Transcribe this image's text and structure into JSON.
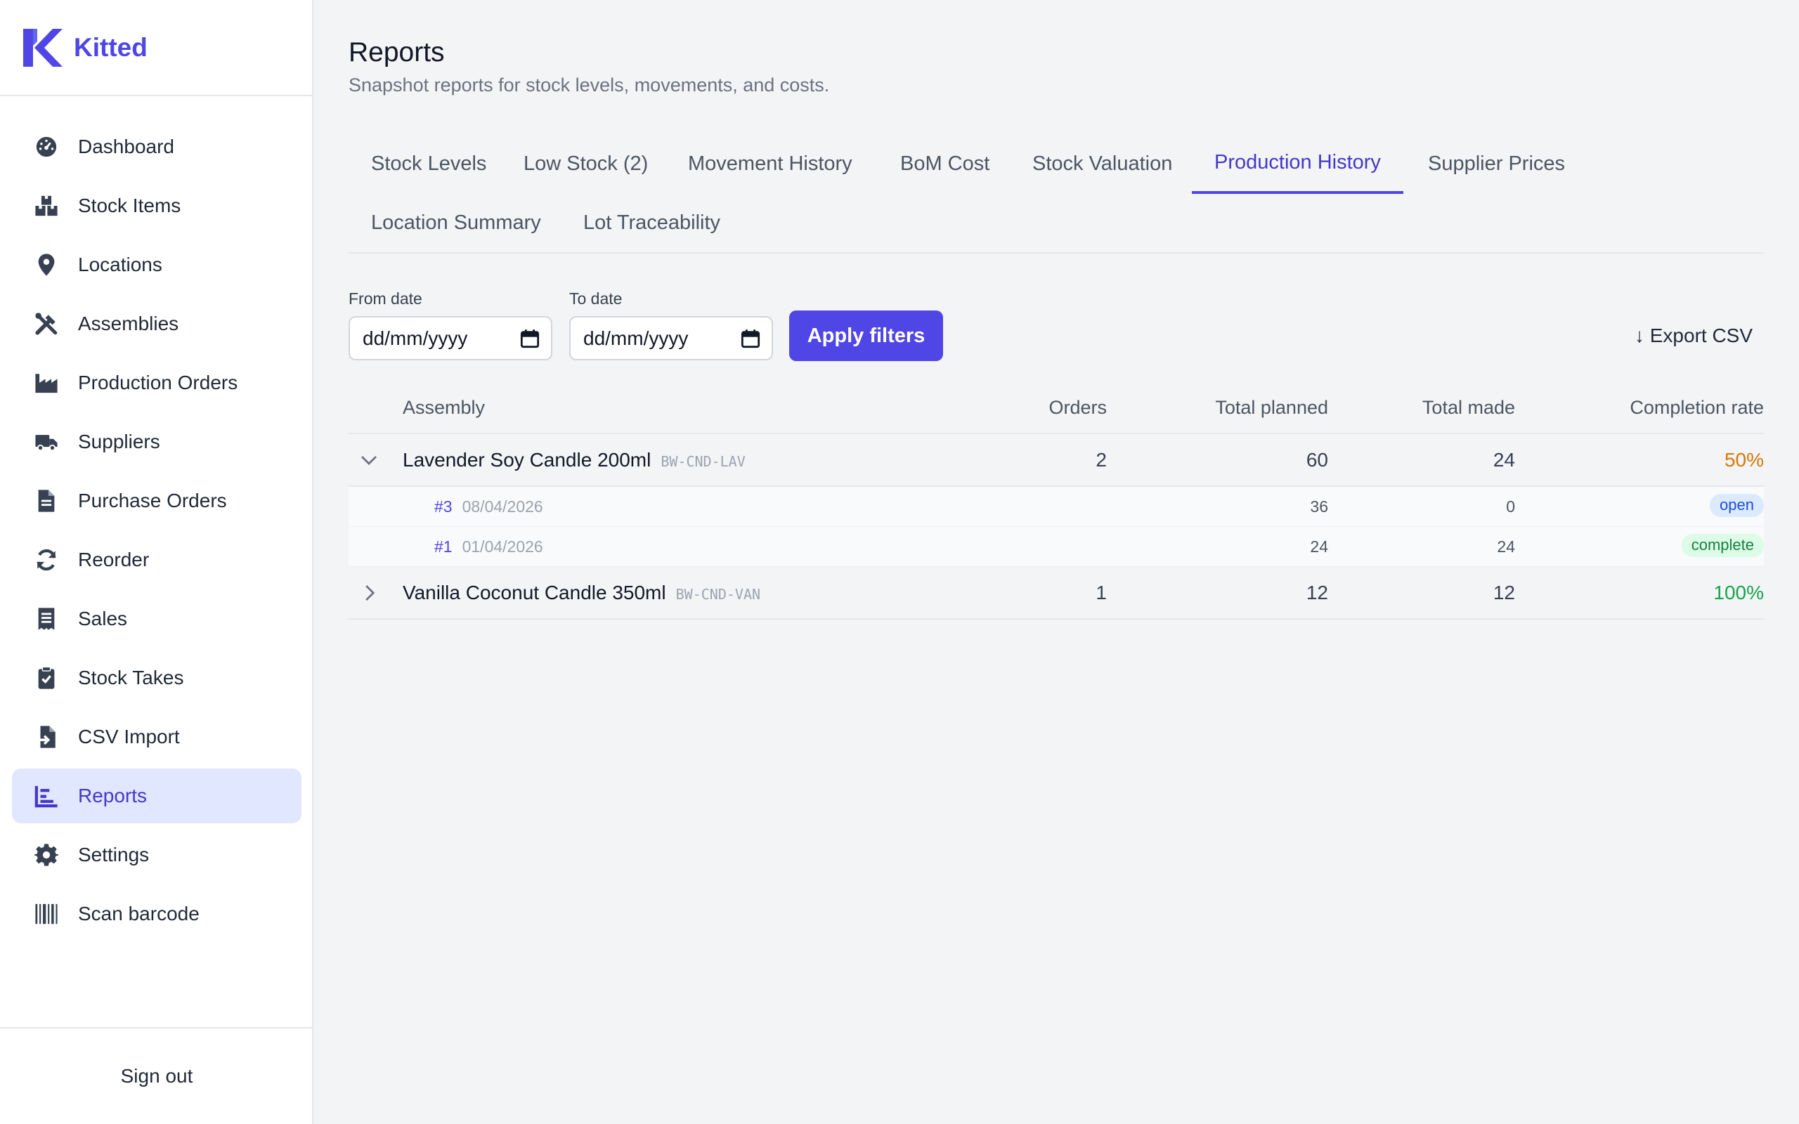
{
  "app": {
    "name": "Kitted"
  },
  "sidebar": {
    "items": [
      {
        "label": "Dashboard",
        "icon": "dashboard-gauge-icon"
      },
      {
        "label": "Stock Items",
        "icon": "boxes-icon"
      },
      {
        "label": "Locations",
        "icon": "location-pin-icon"
      },
      {
        "label": "Assemblies",
        "icon": "tools-icon"
      },
      {
        "label": "Production Orders",
        "icon": "factory-icon"
      },
      {
        "label": "Suppliers",
        "icon": "truck-icon"
      },
      {
        "label": "Purchase Orders",
        "icon": "document-icon"
      },
      {
        "label": "Reorder",
        "icon": "refresh-icon"
      },
      {
        "label": "Sales",
        "icon": "receipt-icon"
      },
      {
        "label": "Stock Takes",
        "icon": "clipboard-check-icon"
      },
      {
        "label": "CSV Import",
        "icon": "file-import-icon"
      },
      {
        "label": "Reports",
        "icon": "chart-icon",
        "active": true
      },
      {
        "label": "Settings",
        "icon": "gear-icon"
      },
      {
        "label": "Scan barcode",
        "icon": "barcode-icon"
      }
    ],
    "sign_out": "Sign out"
  },
  "page": {
    "title": "Reports",
    "subtitle": "Snapshot reports for stock levels, movements, and costs."
  },
  "tabs": [
    {
      "label": "Stock Levels"
    },
    {
      "label": "Low Stock (2)"
    },
    {
      "label": "Movement History"
    },
    {
      "label": "BoM Cost"
    },
    {
      "label": "Stock Valuation"
    },
    {
      "label": "Production History",
      "active": true
    },
    {
      "label": "Supplier Prices"
    },
    {
      "label": "Location Summary"
    },
    {
      "label": "Lot Traceability"
    }
  ],
  "filters": {
    "from_label": "From date",
    "from_placeholder": "dd/mm/yyyy",
    "to_label": "To date",
    "to_placeholder": "dd/mm/yyyy",
    "apply_label": "Apply filters",
    "export_label": "↓ Export CSV"
  },
  "table": {
    "columns": [
      "Assembly",
      "Orders",
      "Total planned",
      "Total made",
      "Completion rate"
    ],
    "rows": [
      {
        "name": "Lavender Soy Candle 200ml",
        "sku": "BW-CND-LAV",
        "orders": "2",
        "planned": "60",
        "made": "24",
        "rate": "50%",
        "expanded": true,
        "children": [
          {
            "id": "#3",
            "date": "08/04/2026",
            "planned": "36",
            "made": "0",
            "status": "open"
          },
          {
            "id": "#1",
            "date": "01/04/2026",
            "planned": "24",
            "made": "24",
            "status": "complete"
          }
        ]
      },
      {
        "name": "Vanilla Coconut Candle 350ml",
        "sku": "BW-CND-VAN",
        "orders": "1",
        "planned": "12",
        "made": "12",
        "rate": "100%",
        "expanded": false
      }
    ]
  },
  "colors": {
    "accent": "#4f46e5",
    "warn": "#d97706",
    "ok": "#16a34a"
  }
}
